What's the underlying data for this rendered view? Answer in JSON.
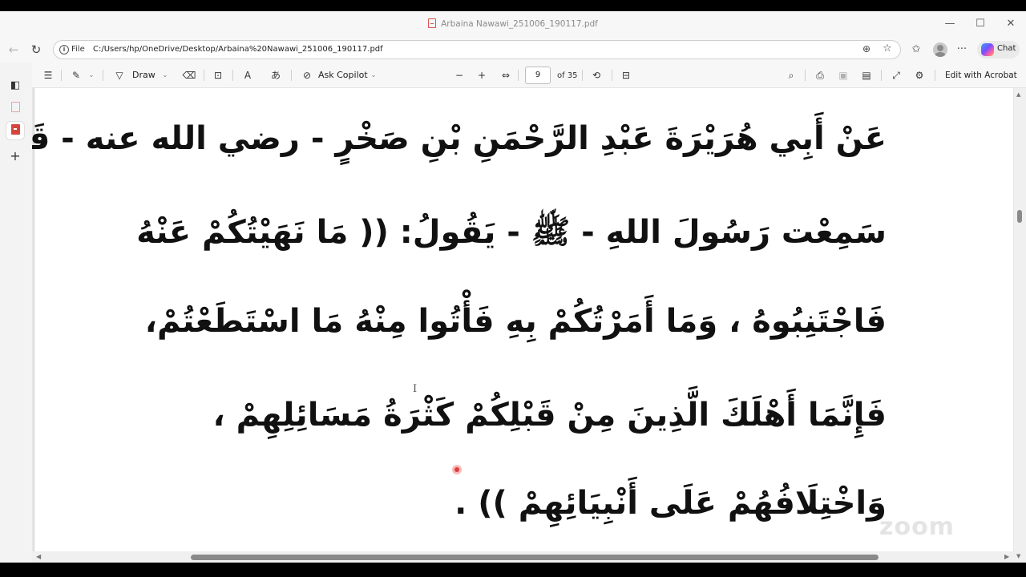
{
  "window": {
    "title": "Arbaina Nawawi_251006_190117.pdf",
    "controls": {
      "minimize": "—",
      "maximize": "☐",
      "close": "✕"
    }
  },
  "address_bar": {
    "back": "←",
    "refresh": "↻",
    "info_glyph": "i",
    "scheme_label": "File",
    "url": "C:/Users/hp/OneDrive/Desktop/Arbaina%20Nawawi_251006_190117.pdf",
    "zoom_glyph": "⊕",
    "favorite_glyph": "☆",
    "favorites_glyph": "✩",
    "more_glyph": "···",
    "chat_label": "Chat"
  },
  "pdf_toolbar": {
    "contents_glyph": "☰",
    "highlight_glyph": "✎",
    "dropdown_glyph": "⌄",
    "draw_glyph": "▽",
    "draw_label": "Draw",
    "erase_glyph": "⌫",
    "textbox_glyph": "⊡",
    "read_aloud_glyph": "A",
    "translate_glyph": "あ",
    "copilot_glyph": "⊘",
    "copilot_label": "Ask Copilot",
    "zoom_out": "−",
    "zoom_in": "+",
    "fit_glyph": "⇔",
    "page_current": "9",
    "page_total": "of 35",
    "rotate_glyph": "⟲",
    "page_view_glyph": "⊟",
    "search_glyph": "⌕",
    "print_glyph": "⎙",
    "save_glyph": "▣",
    "save_as_glyph": "▤",
    "fullscreen_glyph": "⤢",
    "settings_glyph": "⚙",
    "edit_acrobat_label": "Edit with Acrobat"
  },
  "left_rail": {
    "panel_glyph": "◧",
    "add_glyph": "+"
  },
  "document": {
    "lines": [
      "عَنْ أَبِي هُرَيْرَةَ عَبْدِ الرَّحْمَنِ بْنِ صَخْرٍ - رضي الله عنه - قَالَ:",
      "سَمِعْت رَسُولَ اللهِ - ﷺ - يَقُولُ: (( مَا نَهَيْتُكُمْ عَنْهُ",
      "فَاجْتَنِبُوهُ ، وَمَا أَمَرْتُكُمْ بِهِ فَأْتُوا مِنْهُ مَا اسْتَطَعْتُمْ،",
      "فَإِنَّمَا أَهْلَكَ الَّذِينَ مِنْ قَبْلِكُمْ كَثْرَةُ مَسَائِلِهِمْ ،",
      "وَاخْتِلَافُهُمْ عَلَى أَنْبِيَائِهِمْ )) ."
    ],
    "text_cursor": "I",
    "watermark": "zoom"
  },
  "scrollbars": {
    "up": "▲",
    "down": "▼",
    "left": "◀",
    "right": "▶"
  }
}
